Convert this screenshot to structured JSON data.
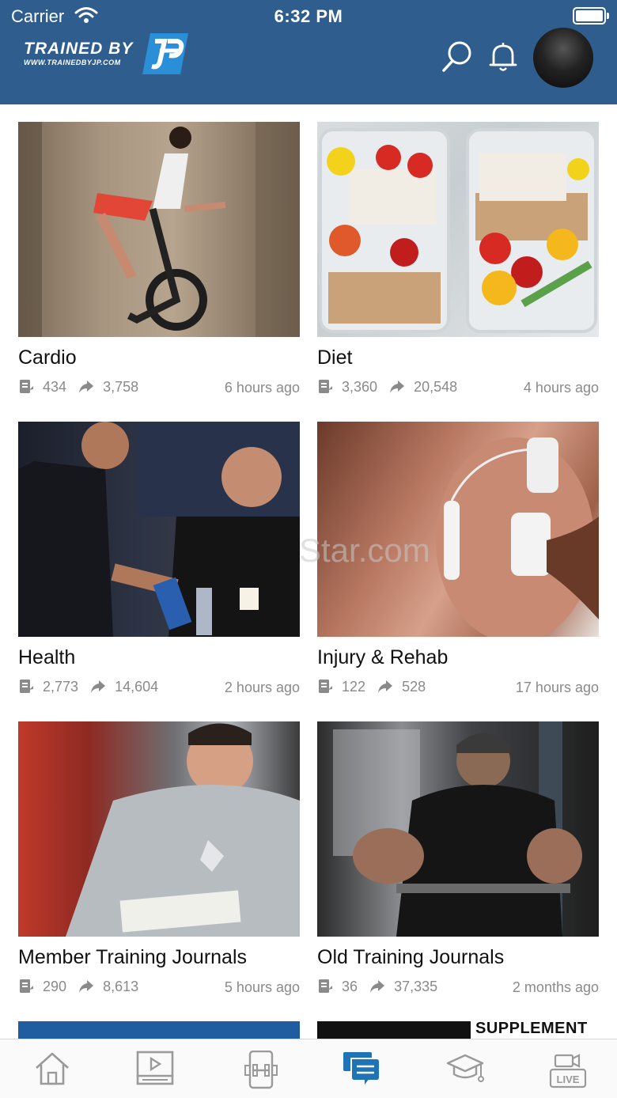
{
  "status_bar": {
    "carrier": "Carrier",
    "time": "6:32 PM"
  },
  "header": {
    "logo_text": "TRAINED BY",
    "logo_url": "WWW.TRAINEDBYJP.COM",
    "brand_color": "#2f5d8e"
  },
  "categories": [
    {
      "title": "Cardio",
      "posts": "434",
      "shares": "3,758",
      "time": "6 hours ago"
    },
    {
      "title": "Diet",
      "posts": "3,360",
      "shares": "20,548",
      "time": "4 hours ago"
    },
    {
      "title": "Health",
      "posts": "2,773",
      "shares": "14,604",
      "time": "2 hours ago"
    },
    {
      "title": "Injury & Rehab",
      "posts": "122",
      "shares": "528",
      "time": "17 hours ago"
    },
    {
      "title": "Member Training Journals",
      "posts": "290",
      "shares": "8,613",
      "time": "5 hours ago"
    },
    {
      "title": "Old Training Journals",
      "posts": "36",
      "shares": "37,335",
      "time": "2 months ago"
    }
  ],
  "peek": {
    "right_label": "SUPPLEMENT FAC"
  },
  "watermark": "Star.com",
  "tabbar": {
    "tabs": [
      {
        "icon": "home-icon",
        "active": false
      },
      {
        "icon": "video-icon",
        "active": false
      },
      {
        "icon": "workout-phone-icon",
        "active": false
      },
      {
        "icon": "forum-icon",
        "active": true
      },
      {
        "icon": "education-icon",
        "active": false
      },
      {
        "icon": "live-icon",
        "active": false
      }
    ],
    "live_label": "LIVE",
    "active_color": "#1f74b8",
    "inactive_color": "#9a9a9a"
  }
}
